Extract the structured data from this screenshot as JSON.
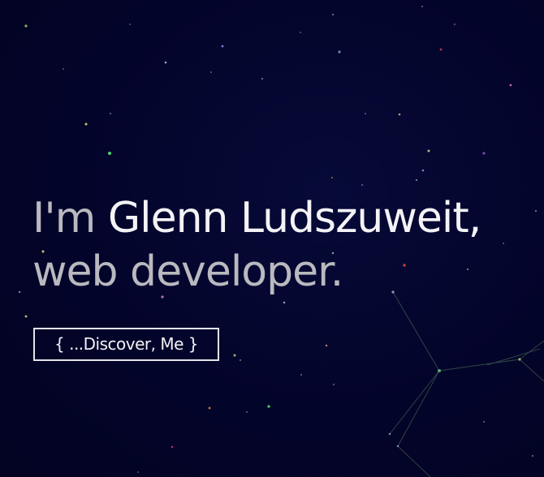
{
  "hero": {
    "greeting": "I'm ",
    "name": "Glenn Ludszuweit",
    "comma": ",",
    "role": "web developer."
  },
  "cta": {
    "label": "{ ...Discover, Me }"
  },
  "colors": {
    "background": "#03042a",
    "text_muted": "#b9b9bf",
    "text_bright": "#f3f3f6",
    "constellation_line": "#3f6a4a"
  }
}
